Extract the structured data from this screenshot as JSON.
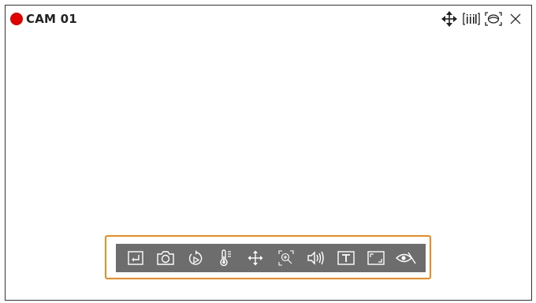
{
  "camera": {
    "title": "CAM 01",
    "recording_color": "#e00000"
  },
  "top_actions": [
    {
      "icon": "move-icon"
    },
    {
      "icon": "info-icon"
    },
    {
      "icon": "fisheye-view-icon"
    },
    {
      "icon": "close-icon"
    }
  ],
  "toolbar": {
    "highlight_color": "#f28a1c",
    "background_color": "#6d6d6d",
    "buttons": [
      {
        "icon": "return-icon"
      },
      {
        "icon": "capture-camera-icon"
      },
      {
        "icon": "playback-icon"
      },
      {
        "icon": "thermal-icon"
      },
      {
        "icon": "ptz-move-icon"
      },
      {
        "icon": "zoom-icon"
      },
      {
        "icon": "audio-icon"
      },
      {
        "icon": "text-icon"
      },
      {
        "icon": "fit-screen-icon"
      },
      {
        "icon": "privacy-view-icon"
      }
    ]
  }
}
